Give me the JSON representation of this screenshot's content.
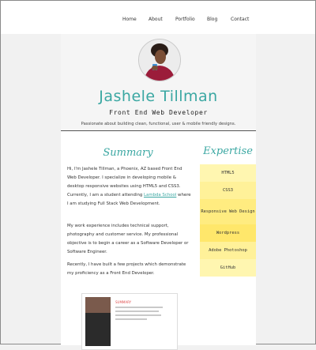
{
  "nav": {
    "items": [
      {
        "label": "Home"
      },
      {
        "label": "About"
      },
      {
        "label": "Portfolio"
      },
      {
        "label": "Blog"
      },
      {
        "label": "Contact"
      }
    ]
  },
  "hero": {
    "name": "Jashele Tillman",
    "role": "Front End Web Developer",
    "tagline": "Passionate about building clean, functional, user & mobile friendly designs."
  },
  "summary": {
    "title": "Summary",
    "p1_before": "Hi, I'm Jashele Tillman, a Phoenix, AZ based Front End Web Developer. I specialize in developing mobile & desktop responsive websites using HTML5 and CSS3. Currently, I am a student attending ",
    "p1_link": "Lambda School",
    "p1_after": " where I am studying Full Stack Web Development.",
    "p2": "My work experience includes technical support, photography and customer service. My professional objective is to begin a career as a Software Developer or Software Engineer.",
    "p3": "Recently, I have built a few projects which demonstrate my proficiency as a Front End Developer.",
    "thumb_title": "SUMMARY"
  },
  "expertise": {
    "title": "Expertise",
    "skills": [
      {
        "label": "HTML5",
        "color": "#fff6b0"
      },
      {
        "label": "CSS3",
        "color": "#fff199"
      },
      {
        "label": "Responsive Web Design",
        "color": "#ffec80"
      },
      {
        "label": "Wordpress",
        "color": "#ffe76b"
      },
      {
        "label": "Adobe Photoshop",
        "color": "#fff199"
      },
      {
        "label": "GitHub",
        "color": "#fff6b0"
      }
    ]
  },
  "colors": {
    "accent": "#3aa7a2"
  }
}
